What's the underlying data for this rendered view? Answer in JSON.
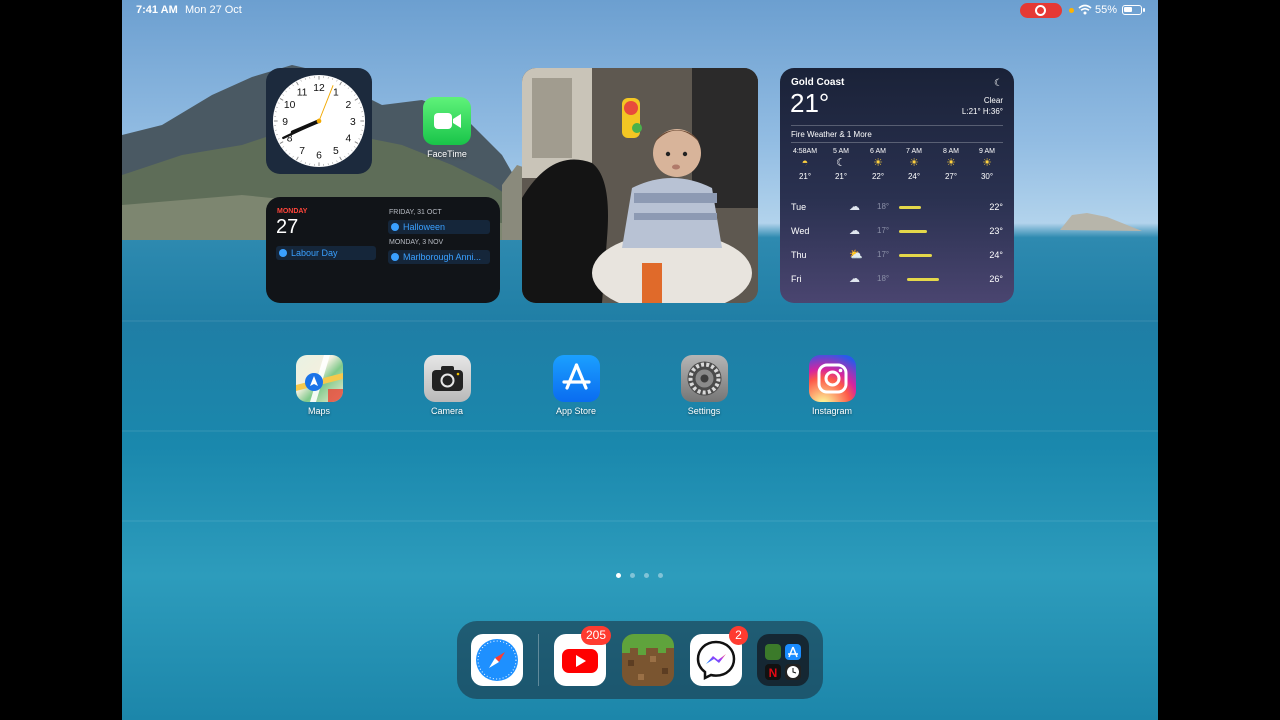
{
  "status_bar": {
    "time": "7:41 AM",
    "date": "Mon 27 Oct",
    "battery": "55%",
    "icons": [
      "screen-recording-icon",
      "wifi-icon",
      "battery-icon"
    ]
  },
  "clock_widget": {
    "numbers": [
      "12",
      "1",
      "2",
      "3",
      "4",
      "5",
      "6",
      "7",
      "8",
      "9",
      "10",
      "11"
    ],
    "time_shown": "7:41"
  },
  "facetime": {
    "label": "FaceTime"
  },
  "calendar_widget": {
    "day_name": "MONDAY",
    "day_number": "27",
    "today_event": "Labour Day",
    "upcoming": [
      {
        "date": "FRIDAY, 31 OCT",
        "event": "Halloween"
      },
      {
        "date": "MONDAY, 3 NOV",
        "event": "Marlborough Anni..."
      }
    ]
  },
  "photo_widget": {
    "subject": "photo-baby-in-bouncer"
  },
  "weather_widget": {
    "city": "Gold Coast",
    "temp": "21°",
    "condition": "Clear",
    "hi_lo": "L:21° H:36°",
    "alert": "Fire Weather & 1 More",
    "hourly": [
      {
        "time": "4:58AM",
        "icon": "sunrise-icon",
        "temp": "21°"
      },
      {
        "time": "5 AM",
        "icon": "moon-icon",
        "temp": "21°"
      },
      {
        "time": "6 AM",
        "icon": "sun-icon",
        "temp": "22°"
      },
      {
        "time": "7 AM",
        "icon": "sun-icon",
        "temp": "24°"
      },
      {
        "time": "8 AM",
        "icon": "sun-icon",
        "temp": "27°"
      },
      {
        "time": "9 AM",
        "icon": "sun-icon",
        "temp": "30°"
      }
    ],
    "daily": [
      {
        "day": "Tue",
        "icon": "rain-icon",
        "lo": "18°",
        "hi": "22°"
      },
      {
        "day": "Wed",
        "icon": "rain-icon",
        "lo": "17°",
        "hi": "23°"
      },
      {
        "day": "Thu",
        "icon": "partly-cloudy-icon",
        "lo": "17°",
        "hi": "24°"
      },
      {
        "day": "Fri",
        "icon": "rain-icon",
        "lo": "18°",
        "hi": "26°"
      }
    ]
  },
  "apps": [
    {
      "label": "Maps",
      "icon": "maps-icon"
    },
    {
      "label": "Camera",
      "icon": "camera-icon"
    },
    {
      "label": "App Store",
      "icon": "app-store-icon"
    },
    {
      "label": "Settings",
      "icon": "settings-icon"
    },
    {
      "label": "Instagram",
      "icon": "instagram-icon"
    }
  ],
  "page_dots": {
    "count": 4,
    "active": 1
  },
  "dock": [
    {
      "app": "Safari",
      "icon": "safari-icon"
    },
    {
      "app": "YouTube",
      "icon": "youtube-icon",
      "badge": "205"
    },
    {
      "app": "Minecraft",
      "icon": "minecraft-icon"
    },
    {
      "app": "Messenger",
      "icon": "messenger-icon",
      "badge": "2"
    },
    {
      "app": "App Library",
      "icon": "app-library-icon"
    }
  ],
  "colors": {
    "badge": "#ff3b30",
    "calendar_accent": "#ff453a",
    "event_blue": "#3aa0ff",
    "weather_bar": "#e4d84a"
  }
}
